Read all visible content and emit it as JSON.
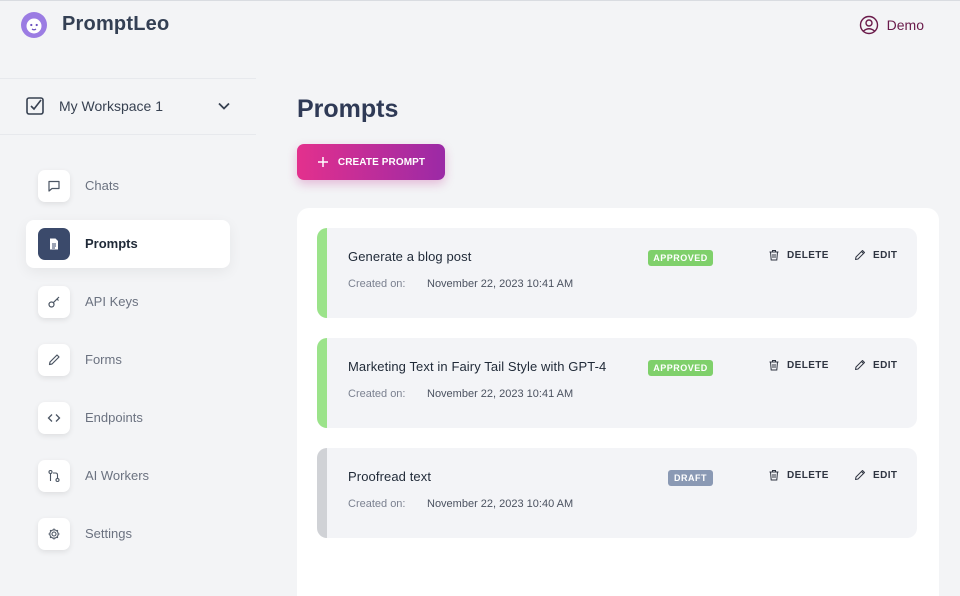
{
  "brand": {
    "name": "PromptLeo"
  },
  "user": {
    "name": "Demo"
  },
  "workspace": {
    "label": "My Workspace 1"
  },
  "nav": {
    "items": [
      {
        "label": "Chats",
        "icon": "chat-icon"
      },
      {
        "label": "Prompts",
        "icon": "document-icon",
        "active": true
      },
      {
        "label": "API Keys",
        "icon": "key-icon"
      },
      {
        "label": "Forms",
        "icon": "pencil-icon"
      },
      {
        "label": "Endpoints",
        "icon": "code-icon"
      },
      {
        "label": "AI Workers",
        "icon": "git-branch-icon"
      },
      {
        "label": "Settings",
        "icon": "gear-icon"
      }
    ]
  },
  "main": {
    "title": "Prompts",
    "create_label": "CREATE PROMPT",
    "prompts": [
      {
        "title": "Generate a blog post",
        "created_label": "Created on:",
        "created_at": "November 22, 2023 10:41 AM",
        "status": "APPROVED",
        "status_color": "#7fd06b",
        "accent_color": "#9be38a",
        "delete_label": "DELETE",
        "edit_label": "EDIT"
      },
      {
        "title": "Marketing Text in Fairy Tail Style with GPT-4",
        "created_label": "Created on:",
        "created_at": "November 22, 2023 10:41 AM",
        "status": "APPROVED",
        "status_color": "#7fd06b",
        "accent_color": "#9be38a",
        "delete_label": "DELETE",
        "edit_label": "EDIT"
      },
      {
        "title": "Proofread text",
        "created_label": "Created on:",
        "created_at": "November 22, 2023 10:40 AM",
        "status": "DRAFT",
        "status_color": "#8a99b4",
        "accent_color": "#d0d2d6",
        "delete_label": "DELETE",
        "edit_label": "EDIT"
      }
    ]
  },
  "colors": {
    "brand_gradient_start": "#e3308d",
    "brand_gradient_end": "#9b2aa6",
    "nav_active_icon_bg": "#3b4a6b"
  }
}
